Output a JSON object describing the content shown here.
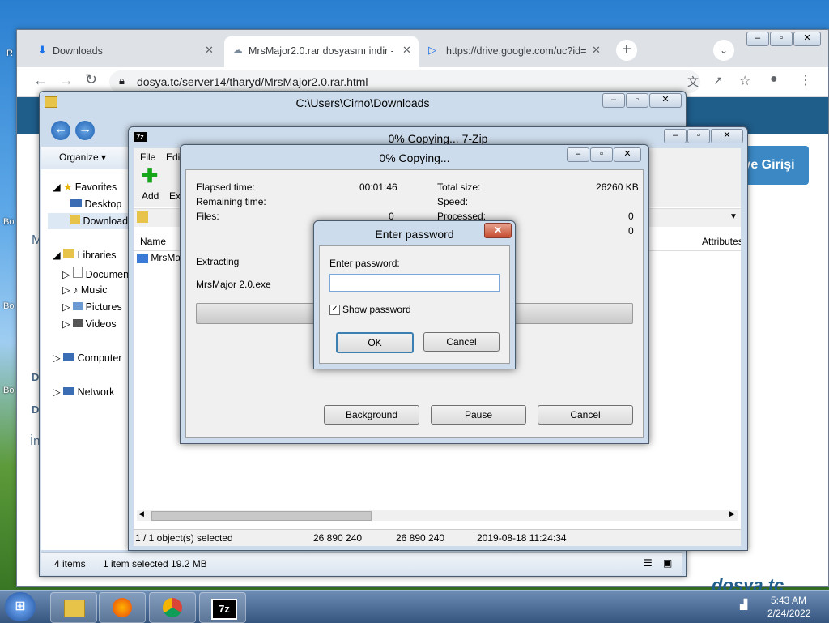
{
  "desktop": {
    "labels": [
      "R",
      "Bo",
      "Bo",
      "Bo"
    ]
  },
  "chrome": {
    "tabs": [
      {
        "label": "Downloads"
      },
      {
        "label": "MrsMajor2.0.rar dosyasını indir -"
      },
      {
        "label": "https://drive.google.com/uc?id="
      }
    ],
    "new_tab": "+",
    "url": "dosya.tc/server14/tharyd/MrsMajor2.0.rar.html",
    "page_login": "ye Girişi",
    "page_side": [
      "M",
      "D",
      "D",
      "İn"
    ],
    "brand": "dosya.tc"
  },
  "explorer": {
    "title": "C:\\Users\\Cirno\\Downloads",
    "organize": "Organize",
    "nav": {
      "favorites": "Favorites",
      "desktop": "Desktop",
      "downloads": "Downloads",
      "libraries": "Libraries",
      "documents": "Documents",
      "music": "Music",
      "pictures": "Pictures",
      "videos": "Videos",
      "computer": "Computer",
      "network": "Network"
    },
    "status_items": "4 items",
    "status_selected": "1 item selected  19.2 MB"
  },
  "sevenzip_fm": {
    "title": "0% Copying... 7-Zip",
    "menu": [
      "File",
      "Edit"
    ],
    "tools": [
      "Add",
      "Ext"
    ],
    "col_name": "Name",
    "col_attr": "Attributes",
    "file": "MrsMa",
    "status": [
      "1 / 1 object(s) selected",
      "26 890 240",
      "26 890 240",
      "2019-08-18 11:24:34"
    ]
  },
  "progress": {
    "title": "0% Copying...",
    "elapsed_label": "Elapsed time:",
    "elapsed_value": "00:01:46",
    "remaining_label": "Remaining time:",
    "files_label": "Files:",
    "files_value": "0",
    "total_label": "Total size:",
    "total_value": "26260 KB",
    "speed_label": "Speed:",
    "processed_label": "Processed:",
    "processed_value": "0",
    "extra_value": "0",
    "action": "Extracting",
    "file": "MrsMajor 2.0.exe",
    "buttons": {
      "background": "Background",
      "pause": "Pause",
      "cancel": "Cancel"
    }
  },
  "password_dialog": {
    "title": "Enter password",
    "label": "Enter password:",
    "value": "",
    "show_password": "Show password",
    "ok": "OK",
    "cancel": "Cancel"
  },
  "taskbar": {
    "time": "5:43 AM",
    "date": "2/24/2022"
  }
}
